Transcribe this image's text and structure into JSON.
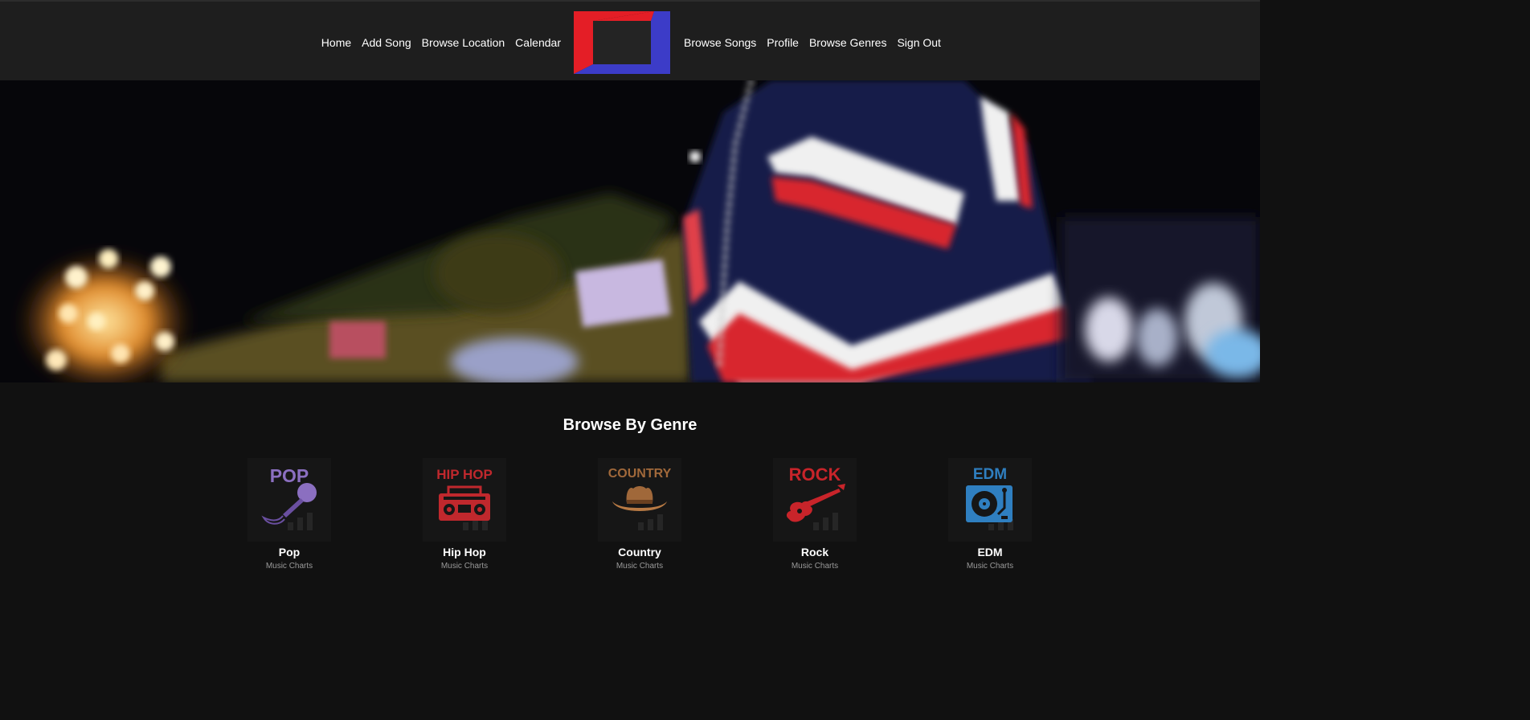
{
  "nav": {
    "left": [
      "Home",
      "Add Song",
      "Browse Location",
      "Calendar"
    ],
    "right": [
      "Browse Songs",
      "Profile",
      "Browse Genres",
      "Sign Out"
    ],
    "logo_colors": {
      "red": "#e41e26",
      "blue": "#3c3cc8",
      "inner": "#242424"
    }
  },
  "hero": {
    "description_icon": "concert-crowd-image"
  },
  "genres_section": {
    "title": "Browse By Genre",
    "genres": [
      {
        "name": "Pop",
        "subtitle": "Music Charts",
        "tile_text": "POP",
        "icon": "microphone-icon",
        "color": "#8b6fc0"
      },
      {
        "name": "Hip Hop",
        "subtitle": "Music Charts",
        "tile_text": "HIP HOP",
        "icon": "boombox-icon",
        "color": "#c0282d"
      },
      {
        "name": "Country",
        "subtitle": "Music Charts",
        "tile_text": "COUNTRY",
        "icon": "cowboy-hat-icon",
        "color": "#a0683a"
      },
      {
        "name": "Rock",
        "subtitle": "Music Charts",
        "tile_text": "ROCK",
        "icon": "electric-guitar-icon",
        "color": "#c8242a"
      },
      {
        "name": "EDM",
        "subtitle": "Music Charts",
        "tile_text": "EDM",
        "icon": "turntable-icon",
        "color": "#2f7fc0"
      }
    ]
  }
}
